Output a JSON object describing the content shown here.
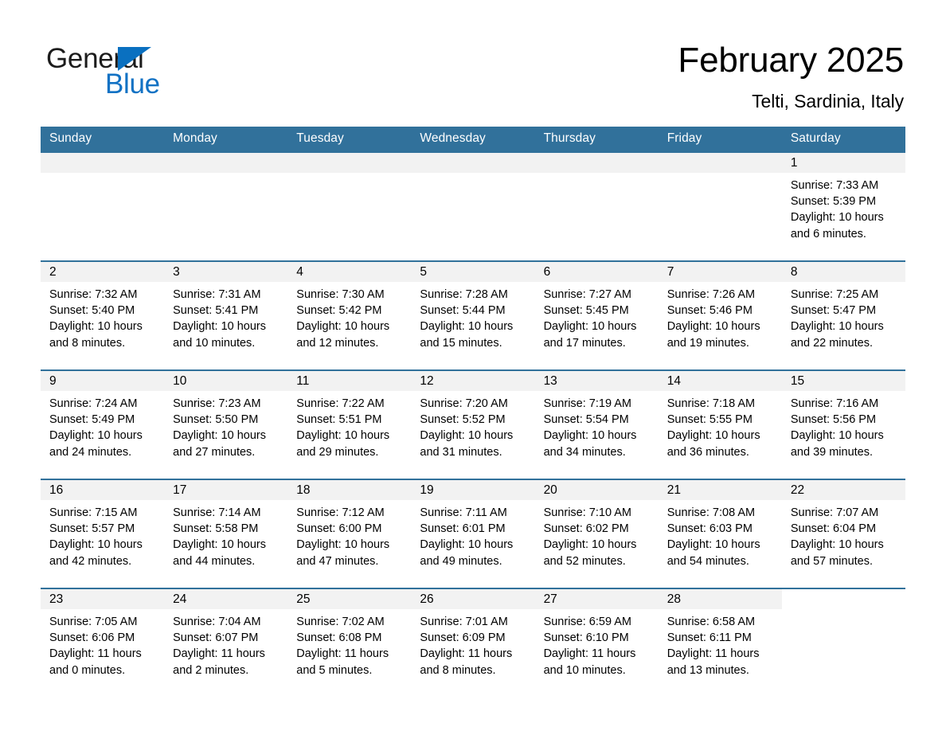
{
  "brand": {
    "name_part1": "General",
    "name_part2": "Blue",
    "triangle_color": "#0a70c0",
    "blue_color": "#1272c4"
  },
  "header": {
    "month_year": "February 2025",
    "location": "Telti, Sardinia, Italy",
    "accent_color": "#31719B",
    "daynum_band_color": "#F2F2F2"
  },
  "weekday_headers": [
    "Sunday",
    "Monday",
    "Tuesday",
    "Wednesday",
    "Thursday",
    "Friday",
    "Saturday"
  ],
  "weeks": [
    {
      "cells": [
        {
          "blank": true,
          "shaded": true
        },
        {
          "blank": true,
          "shaded": true
        },
        {
          "blank": true,
          "shaded": true
        },
        {
          "blank": true,
          "shaded": true
        },
        {
          "blank": true,
          "shaded": true
        },
        {
          "blank": true,
          "shaded": true
        },
        {
          "day": "1",
          "sunrise": "Sunrise: 7:33 AM",
          "sunset": "Sunset: 5:39 PM",
          "daylight_1": "Daylight: 10 hours",
          "daylight_2": "and 6 minutes."
        }
      ]
    },
    {
      "cells": [
        {
          "day": "2",
          "sunrise": "Sunrise: 7:32 AM",
          "sunset": "Sunset: 5:40 PM",
          "daylight_1": "Daylight: 10 hours",
          "daylight_2": "and 8 minutes."
        },
        {
          "day": "3",
          "sunrise": "Sunrise: 7:31 AM",
          "sunset": "Sunset: 5:41 PM",
          "daylight_1": "Daylight: 10 hours",
          "daylight_2": "and 10 minutes."
        },
        {
          "day": "4",
          "sunrise": "Sunrise: 7:30 AM",
          "sunset": "Sunset: 5:42 PM",
          "daylight_1": "Daylight: 10 hours",
          "daylight_2": "and 12 minutes."
        },
        {
          "day": "5",
          "sunrise": "Sunrise: 7:28 AM",
          "sunset": "Sunset: 5:44 PM",
          "daylight_1": "Daylight: 10 hours",
          "daylight_2": "and 15 minutes."
        },
        {
          "day": "6",
          "sunrise": "Sunrise: 7:27 AM",
          "sunset": "Sunset: 5:45 PM",
          "daylight_1": "Daylight: 10 hours",
          "daylight_2": "and 17 minutes."
        },
        {
          "day": "7",
          "sunrise": "Sunrise: 7:26 AM",
          "sunset": "Sunset: 5:46 PM",
          "daylight_1": "Daylight: 10 hours",
          "daylight_2": "and 19 minutes."
        },
        {
          "day": "8",
          "sunrise": "Sunrise: 7:25 AM",
          "sunset": "Sunset: 5:47 PM",
          "daylight_1": "Daylight: 10 hours",
          "daylight_2": "and 22 minutes."
        }
      ]
    },
    {
      "cells": [
        {
          "day": "9",
          "sunrise": "Sunrise: 7:24 AM",
          "sunset": "Sunset: 5:49 PM",
          "daylight_1": "Daylight: 10 hours",
          "daylight_2": "and 24 minutes."
        },
        {
          "day": "10",
          "sunrise": "Sunrise: 7:23 AM",
          "sunset": "Sunset: 5:50 PM",
          "daylight_1": "Daylight: 10 hours",
          "daylight_2": "and 27 minutes."
        },
        {
          "day": "11",
          "sunrise": "Sunrise: 7:22 AM",
          "sunset": "Sunset: 5:51 PM",
          "daylight_1": "Daylight: 10 hours",
          "daylight_2": "and 29 minutes."
        },
        {
          "day": "12",
          "sunrise": "Sunrise: 7:20 AM",
          "sunset": "Sunset: 5:52 PM",
          "daylight_1": "Daylight: 10 hours",
          "daylight_2": "and 31 minutes."
        },
        {
          "day": "13",
          "sunrise": "Sunrise: 7:19 AM",
          "sunset": "Sunset: 5:54 PM",
          "daylight_1": "Daylight: 10 hours",
          "daylight_2": "and 34 minutes."
        },
        {
          "day": "14",
          "sunrise": "Sunrise: 7:18 AM",
          "sunset": "Sunset: 5:55 PM",
          "daylight_1": "Daylight: 10 hours",
          "daylight_2": "and 36 minutes."
        },
        {
          "day": "15",
          "sunrise": "Sunrise: 7:16 AM",
          "sunset": "Sunset: 5:56 PM",
          "daylight_1": "Daylight: 10 hours",
          "daylight_2": "and 39 minutes."
        }
      ]
    },
    {
      "cells": [
        {
          "day": "16",
          "sunrise": "Sunrise: 7:15 AM",
          "sunset": "Sunset: 5:57 PM",
          "daylight_1": "Daylight: 10 hours",
          "daylight_2": "and 42 minutes."
        },
        {
          "day": "17",
          "sunrise": "Sunrise: 7:14 AM",
          "sunset": "Sunset: 5:58 PM",
          "daylight_1": "Daylight: 10 hours",
          "daylight_2": "and 44 minutes."
        },
        {
          "day": "18",
          "sunrise": "Sunrise: 7:12 AM",
          "sunset": "Sunset: 6:00 PM",
          "daylight_1": "Daylight: 10 hours",
          "daylight_2": "and 47 minutes."
        },
        {
          "day": "19",
          "sunrise": "Sunrise: 7:11 AM",
          "sunset": "Sunset: 6:01 PM",
          "daylight_1": "Daylight: 10 hours",
          "daylight_2": "and 49 minutes."
        },
        {
          "day": "20",
          "sunrise": "Sunrise: 7:10 AM",
          "sunset": "Sunset: 6:02 PM",
          "daylight_1": "Daylight: 10 hours",
          "daylight_2": "and 52 minutes."
        },
        {
          "day": "21",
          "sunrise": "Sunrise: 7:08 AM",
          "sunset": "Sunset: 6:03 PM",
          "daylight_1": "Daylight: 10 hours",
          "daylight_2": "and 54 minutes."
        },
        {
          "day": "22",
          "sunrise": "Sunrise: 7:07 AM",
          "sunset": "Sunset: 6:04 PM",
          "daylight_1": "Daylight: 10 hours",
          "daylight_2": "and 57 minutes."
        }
      ]
    },
    {
      "cells": [
        {
          "day": "23",
          "sunrise": "Sunrise: 7:05 AM",
          "sunset": "Sunset: 6:06 PM",
          "daylight_1": "Daylight: 11 hours",
          "daylight_2": "and 0 minutes."
        },
        {
          "day": "24",
          "sunrise": "Sunrise: 7:04 AM",
          "sunset": "Sunset: 6:07 PM",
          "daylight_1": "Daylight: 11 hours",
          "daylight_2": "and 2 minutes."
        },
        {
          "day": "25",
          "sunrise": "Sunrise: 7:02 AM",
          "sunset": "Sunset: 6:08 PM",
          "daylight_1": "Daylight: 11 hours",
          "daylight_2": "and 5 minutes."
        },
        {
          "day": "26",
          "sunrise": "Sunrise: 7:01 AM",
          "sunset": "Sunset: 6:09 PM",
          "daylight_1": "Daylight: 11 hours",
          "daylight_2": "and 8 minutes."
        },
        {
          "day": "27",
          "sunrise": "Sunrise: 6:59 AM",
          "sunset": "Sunset: 6:10 PM",
          "daylight_1": "Daylight: 11 hours",
          "daylight_2": "and 10 minutes."
        },
        {
          "day": "28",
          "sunrise": "Sunrise: 6:58 AM",
          "sunset": "Sunset: 6:11 PM",
          "daylight_1": "Daylight: 11 hours",
          "daylight_2": "and 13 minutes."
        },
        {
          "blank": true,
          "shaded": false
        }
      ]
    }
  ]
}
